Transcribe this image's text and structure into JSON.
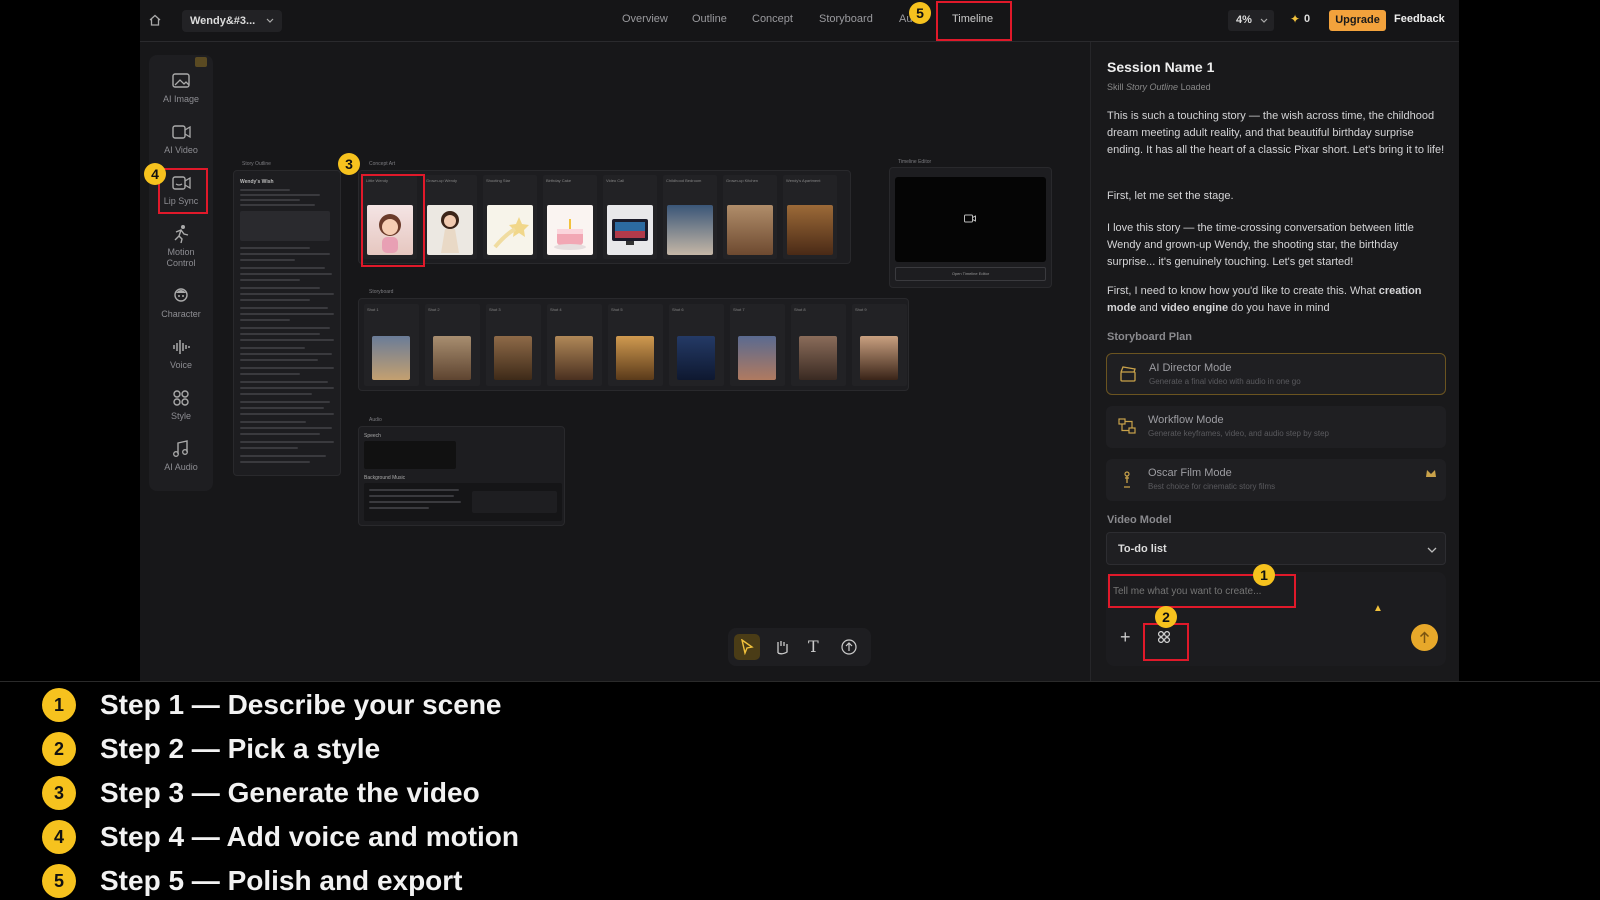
{
  "app": {
    "project_name": "Wendy&#3...",
    "tabs": [
      "Overview",
      "Outline",
      "Concept",
      "Storyboard",
      "Au",
      "Timeline"
    ],
    "zoom": "4%",
    "credits": "0",
    "upgrade_label": "Upgrade",
    "feedback_label": "Feedback"
  },
  "sidebar": {
    "items": [
      {
        "label": "AI Image",
        "icon": "image-icon"
      },
      {
        "label": "AI Video",
        "icon": "video-icon"
      },
      {
        "label": "Lip Sync",
        "icon": "lip-sync-icon"
      },
      {
        "label": "Motion Control",
        "icon": "motion-icon"
      },
      {
        "label": "Character",
        "icon": "character-icon"
      },
      {
        "label": "Voice",
        "icon": "voice-icon"
      },
      {
        "label": "Style",
        "icon": "style-icon"
      },
      {
        "label": "AI Audio",
        "icon": "audio-icon"
      }
    ]
  },
  "canvas": {
    "story_outline_title": "Story Outline",
    "story_outline_heading": "Wendy's Wish",
    "concept_title": "Concept Art",
    "concept_items": [
      "Little Wendy",
      "Grown-up Wendy",
      "Shooting Star",
      "Birthday Cake",
      "Video Call",
      "Childhood Bedroom",
      "Grown-up Kitchen",
      "Wendy's Apartment"
    ],
    "storyboard_title": "Storyboard",
    "storyboard_items": [
      "Shot 1",
      "Shot 2",
      "Shot 3",
      "Shot 4",
      "Shot 5",
      "Shot 6",
      "Shot 7",
      "Shot 8",
      "Shot 9"
    ],
    "audio_title": "Audio",
    "audio_speech": "Speech",
    "audio_bg": "Background Music",
    "timeline_title": "Timeline Editor",
    "timeline_button": "Open Timeline Editor"
  },
  "panel": {
    "session_name": "Session Name 1",
    "skill_prefix": "Skill",
    "skill_name": "Story Outline",
    "skill_suffix": "Loaded",
    "para1": "This is such a touching story — the wish across time, the childhood dream meeting adult reality, and that beautiful birthday surprise ending. It has all the heart of a classic Pixar short. Let's bring it to life!",
    "para2": "First, let me set the stage.",
    "para3": "I love this story — the time-crossing conversation between little Wendy and grown-up Wendy, the shooting star, the birthday surprise... it's genuinely touching. Let's get started!",
    "para4_a": "First, I need to know how you'd like to create this. What",
    "para4_b": "creation mode",
    "para4_c": "and",
    "para4_d": "video engine",
    "para4_e": "do you have in mind",
    "storyboard_plan": "Storyboard Plan",
    "modes": [
      {
        "title": "AI Director Mode",
        "desc": "Generate a final video with audio in one go"
      },
      {
        "title": "Workflow Mode",
        "desc": "Generate keyframes, video, and audio step by step"
      },
      {
        "title": "Oscar Film Mode",
        "desc": "Best choice for cinematic story films"
      }
    ],
    "video_model_label": "Video Model",
    "video_model_value": "To-do list",
    "input_placeholder": "Tell me what you want to create..."
  },
  "markers": [
    "1",
    "2",
    "3",
    "4",
    "5"
  ],
  "steps": [
    {
      "num": "1",
      "text": "Step 1 — Describe your scene"
    },
    {
      "num": "2",
      "text": "Step 2 — Pick a style"
    },
    {
      "num": "3",
      "text": "Step 3 — Generate the video"
    },
    {
      "num": "4",
      "text": "Step 4 — Add voice and motion"
    },
    {
      "num": "5",
      "text": "Step 5 — Polish and export"
    }
  ],
  "colors": {
    "accent": "#f2a23c",
    "highlight": "#e0192a",
    "marker": "#f6c21e"
  }
}
